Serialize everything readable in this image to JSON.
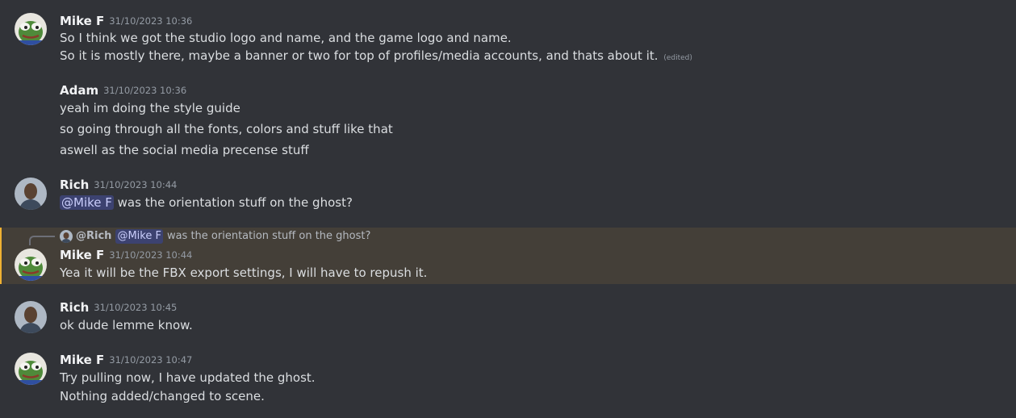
{
  "messages": [
    {
      "author": "Mike F",
      "timestamp": "31/10/2023 10:36",
      "avatar_icon": "pepe-frog-avatar",
      "lines": [
        "So I think we got the studio logo and name, and the game logo and name.",
        "So it is mostly there, maybe a banner or two for top of profiles/media accounts, and thats about it."
      ],
      "edited_label": "(edited)"
    },
    {
      "author": "Adam",
      "timestamp": "31/10/2023 10:36",
      "lines": [
        "yeah im doing the style guide",
        "so going through all the fonts, colors and stuff like that",
        "aswell as the social media precense stuff"
      ]
    },
    {
      "author": "Rich",
      "timestamp": "31/10/2023 10:44",
      "avatar_icon": "user-photo-avatar",
      "mention": "@Mike F",
      "text": " was the orientation stuff on the ghost?"
    },
    {
      "author": "Mike F",
      "timestamp": "31/10/2023 10:44",
      "avatar_icon": "pepe-frog-avatar",
      "highlighted": true,
      "reply": {
        "author": "@Rich",
        "mention": "@Mike F",
        "text": "was the orientation stuff on the ghost?"
      },
      "lines": [
        "Yea it will be the FBX export settings, I will have to repush it."
      ]
    },
    {
      "author": "Rich",
      "timestamp": "31/10/2023 10:45",
      "avatar_icon": "user-photo-avatar",
      "lines": [
        "ok dude lemme know."
      ]
    },
    {
      "author": "Mike F",
      "timestamp": "31/10/2023 10:47",
      "avatar_icon": "pepe-frog-avatar",
      "lines": [
        "Try pulling now, I have updated the ghost.",
        "Nothing added/changed to scene."
      ]
    }
  ],
  "colors": {
    "background": "#313338",
    "highlight": "#443f38",
    "highlight_bar": "#f0b132",
    "mention_bg": "#3c4270",
    "mention_text": "#c9cdfb"
  }
}
